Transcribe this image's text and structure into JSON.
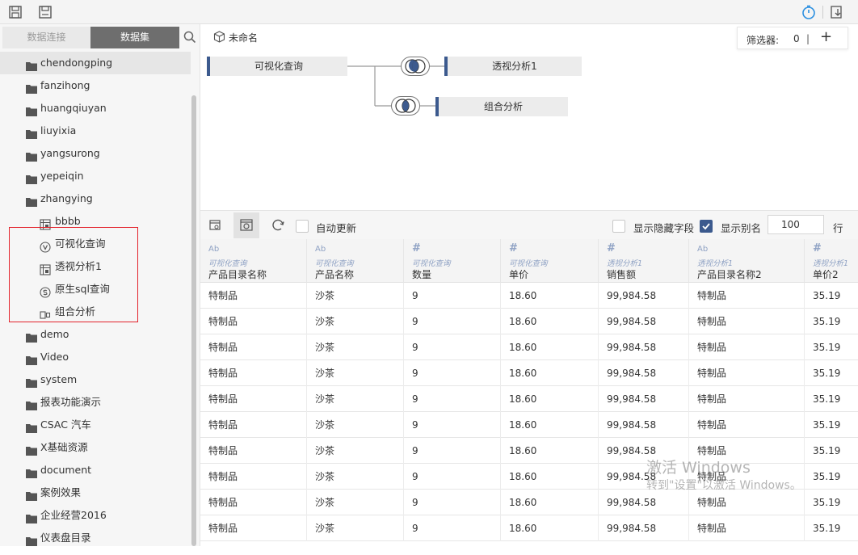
{
  "toolbar": {
    "icons": [
      "save-icon",
      "save-as-icon",
      "timer-icon",
      "export-icon"
    ]
  },
  "left_panel": {
    "tabs": [
      {
        "label": "数据连接",
        "active": false
      },
      {
        "label": "数据集",
        "active": true
      }
    ],
    "tree": [
      {
        "label": "chendongping",
        "type": "folder",
        "selected": true
      },
      {
        "label": "fanzihong",
        "type": "folder"
      },
      {
        "label": "huangqiuyan",
        "type": "folder"
      },
      {
        "label": "liuyixia",
        "type": "folder"
      },
      {
        "label": "yangsurong",
        "type": "folder"
      },
      {
        "label": "yepeiqin",
        "type": "folder"
      },
      {
        "label": "zhangying",
        "type": "folder"
      },
      {
        "label": "bbbb",
        "type": "pivot"
      },
      {
        "label": "可视化查询",
        "type": "visual"
      },
      {
        "label": "透视分析1",
        "type": "pivot"
      },
      {
        "label": "原生sql查询",
        "type": "sql"
      },
      {
        "label": "组合分析",
        "type": "combo"
      },
      {
        "label": "demo",
        "type": "folder"
      },
      {
        "label": "Video",
        "type": "folder"
      },
      {
        "label": "system",
        "type": "folder"
      },
      {
        "label": "报表功能演示",
        "type": "folder"
      },
      {
        "label": "CSAC 汽车",
        "type": "folder"
      },
      {
        "label": "X基础资源",
        "type": "folder"
      },
      {
        "label": "document",
        "type": "folder"
      },
      {
        "label": "案例效果",
        "type": "folder"
      },
      {
        "label": "企业经营2016",
        "type": "folder"
      },
      {
        "label": "仪表盘目录",
        "type": "folder"
      }
    ]
  },
  "main": {
    "title": "未命名",
    "filter": {
      "label": "筛选器:",
      "count": "0",
      "separator": "|",
      "add": "+"
    },
    "flow_nodes": {
      "source": "可视化查询",
      "pivot": "透视分析1",
      "combo": "组合分析"
    },
    "grid_toolbar": {
      "auto_update": "自动更新",
      "show_hidden": "显示隐藏字段",
      "show_alias": "显示别名",
      "rows_value": "100",
      "rows_unit": "行"
    },
    "columns": [
      {
        "type": "Ab",
        "source": "可视化查询",
        "name": "产品目录名称"
      },
      {
        "type": "Ab",
        "source": "可视化查询",
        "name": "产品名称"
      },
      {
        "type": "#",
        "source": "可视化查询",
        "name": "数量"
      },
      {
        "type": "#",
        "source": "可视化查询",
        "name": "单价"
      },
      {
        "type": "#",
        "source": "透视分析1",
        "name": "销售额"
      },
      {
        "type": "Ab",
        "source": "透视分析1",
        "name": "产品目录名称2"
      },
      {
        "type": "#",
        "source": "透视分析1",
        "name": "单价2"
      }
    ],
    "rows": [
      [
        "特制品",
        "沙茶",
        "9",
        "18.60",
        "99,984.58",
        "特制品",
        "35.19"
      ],
      [
        "特制品",
        "沙茶",
        "9",
        "18.60",
        "99,984.58",
        "特制品",
        "35.19"
      ],
      [
        "特制品",
        "沙茶",
        "9",
        "18.60",
        "99,984.58",
        "特制品",
        "35.19"
      ],
      [
        "特制品",
        "沙茶",
        "9",
        "18.60",
        "99,984.58",
        "特制品",
        "35.19"
      ],
      [
        "特制品",
        "沙茶",
        "9",
        "18.60",
        "99,984.58",
        "特制品",
        "35.19"
      ],
      [
        "特制品",
        "沙茶",
        "9",
        "18.60",
        "99,984.58",
        "特制品",
        "35.19"
      ],
      [
        "特制品",
        "沙茶",
        "9",
        "18.60",
        "99,984.58",
        "特制品",
        "35.19"
      ],
      [
        "特制品",
        "沙茶",
        "9",
        "18.60",
        "99,984.58",
        "特制品",
        "35.19"
      ],
      [
        "特制品",
        "沙茶",
        "9",
        "18.60",
        "99,984.58",
        "特制品",
        "35.19"
      ],
      [
        "特制品",
        "沙茶",
        "9",
        "18.60",
        "99,984.58",
        "特制品",
        "35.19"
      ]
    ]
  },
  "watermark": {
    "line1": "激活 Windows",
    "line2": "转到\"设置\"以激活 Windows。"
  },
  "colors": {
    "accent": "#3c5a8e",
    "highlight_box": "#e3232c",
    "type_icon": "#8fa2c4"
  }
}
